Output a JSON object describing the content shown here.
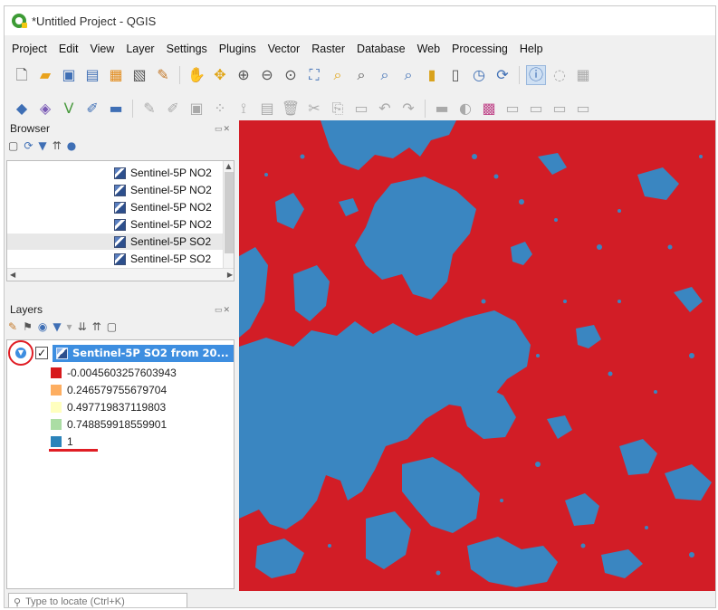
{
  "window": {
    "title": "*Untitled Project - QGIS"
  },
  "menu": [
    "Project",
    "Edit",
    "View",
    "Layer",
    "Settings",
    "Plugins",
    "Vector",
    "Raster",
    "Database",
    "Web",
    "Processing",
    "Help"
  ],
  "browser": {
    "title": "Browser",
    "items": [
      "Sentinel-5P NO2",
      "Sentinel-5P NO2",
      "Sentinel-5P NO2",
      "Sentinel-5P NO2",
      "Sentinel-5P SO2",
      "Sentinel-5P SO2"
    ],
    "selected_index": 4
  },
  "layers": {
    "title": "Layers",
    "layer_name": "Sentinel-5P SO2 from 20...",
    "checked": true,
    "legend": [
      {
        "label": "-0.0045603257603943",
        "color": "#d7191c"
      },
      {
        "label": "0.246579755679704",
        "color": "#fdae61"
      },
      {
        "label": "0.497719837119803",
        "color": "#ffffbf"
      },
      {
        "label": "0.748859918559901",
        "color": "#abdda4"
      },
      {
        "label": "1",
        "color": "#2b83ba"
      }
    ]
  },
  "map_colors": {
    "background": "#d21d26",
    "feature": "#3a86c1"
  },
  "locator": {
    "placeholder": "Type to locate (Ctrl+K)"
  }
}
